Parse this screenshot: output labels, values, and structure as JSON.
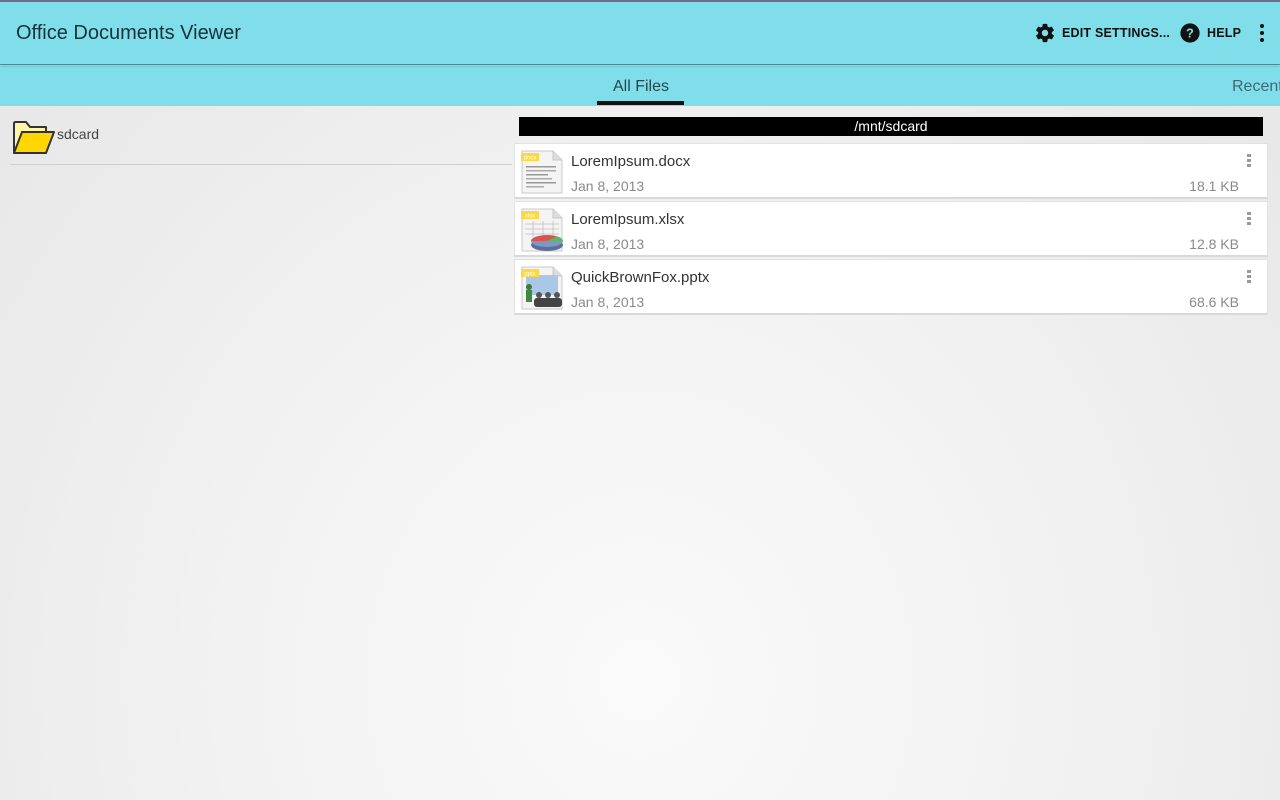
{
  "app": {
    "title": "Office Documents Viewer",
    "accent_color": "#80deea"
  },
  "actionbar": {
    "settings_label": "EDIT SETTINGS...",
    "settings_icon": "gear-icon",
    "help_label": "HELP",
    "help_icon": "help-circle-icon",
    "overflow_icon": "overflow-menu-icon"
  },
  "tabs": [
    {
      "label": "All Files",
      "selected": true
    },
    {
      "label": "Recent",
      "selected": false
    }
  ],
  "sidebar": {
    "folders": [
      {
        "label": "sdcard",
        "icon": "folder-open-icon"
      }
    ]
  },
  "main": {
    "path": "/mnt/sdcard",
    "files": [
      {
        "name": "LoremIpsum.docx",
        "date": "Jan 8, 2013",
        "size": "18.1 KB",
        "type": "docx",
        "icon": "docx-file-icon"
      },
      {
        "name": "LoremIpsum.xlsx",
        "date": "Jan 8, 2013",
        "size": "12.8 KB",
        "type": "xlsx",
        "icon": "xlsx-file-icon"
      },
      {
        "name": "QuickBrownFox.pptx",
        "date": "Jan 8, 2013",
        "size": "68.6 KB",
        "type": "pptx",
        "icon": "pptx-file-icon"
      }
    ]
  }
}
